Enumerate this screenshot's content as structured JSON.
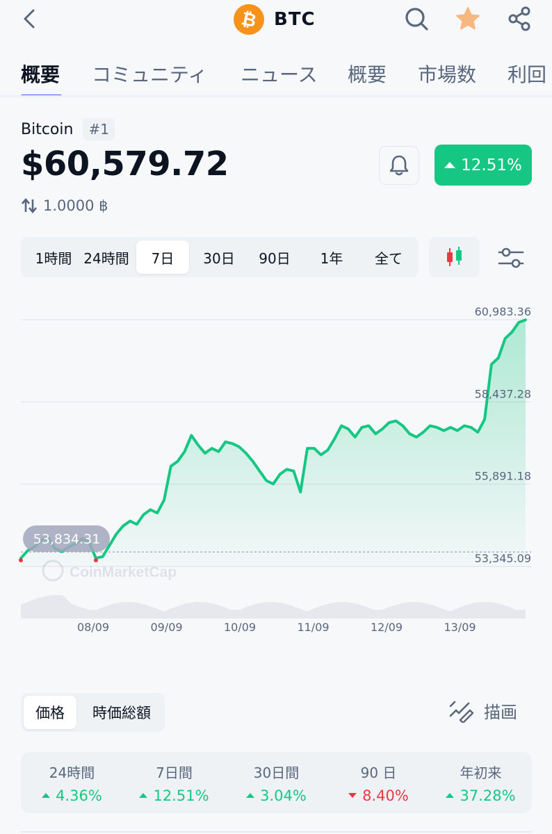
{
  "header": {
    "symbol": "BTC",
    "logo_glyph": "₿",
    "icons": [
      "back-icon",
      "search-icon",
      "star-icon",
      "share-icon"
    ],
    "accent": "#f7931a",
    "star_color": "#f6b87e"
  },
  "tabs": [
    {
      "label": "概要",
      "active": true
    },
    {
      "label": "コミュニティ",
      "active": false
    },
    {
      "label": "ニュース",
      "active": false
    },
    {
      "label": "概要",
      "active": false
    },
    {
      "label": "市場数",
      "active": false
    },
    {
      "label": "利回",
      "active": false
    }
  ],
  "coin": {
    "name": "Bitcoin",
    "rank": "#1",
    "price": "$60,579.72",
    "change": "12.51%",
    "change_color": "#16c784",
    "btc_amount": "1.0000 ฿"
  },
  "ranges": [
    {
      "label": "1時間",
      "active": false
    },
    {
      "label": "24時間",
      "active": false
    },
    {
      "label": "7日",
      "active": true
    },
    {
      "label": "30日",
      "active": false
    },
    {
      "label": "90日",
      "active": false
    },
    {
      "label": "1年",
      "active": false
    },
    {
      "label": "全て",
      "active": false
    }
  ],
  "chart_data": {
    "type": "area",
    "y_ticks": [
      "60,983.36",
      "58,437.28",
      "55,891.18",
      "53,345.09"
    ],
    "ylim": [
      53345.09,
      60983.36
    ],
    "x_ticks": [
      "08/09",
      "09/09",
      "10/09",
      "11/09",
      "12/09",
      "13/09"
    ],
    "open_label": "53,834.31",
    "watermark": "CoinMarketCap",
    "line_color": "#16c784",
    "series": [
      {
        "values": [
          53600,
          53834,
          53950,
          54150,
          54250,
          53900,
          53800,
          53950,
          54050,
          54200,
          54100,
          53600,
          53650,
          54000,
          54350,
          54600,
          54750,
          54650,
          54950,
          55100,
          55000,
          55400,
          56450,
          56600,
          56900,
          57400,
          57100,
          56850,
          57000,
          56900,
          57200,
          57150,
          57050,
          56850,
          56600,
          56300,
          56000,
          55900,
          56200,
          56350,
          56300,
          55650,
          57000,
          57000,
          56800,
          56950,
          57300,
          57700,
          57600,
          57350,
          57650,
          57700,
          57450,
          57600,
          57800,
          57850,
          57700,
          57450,
          57350,
          57500,
          57700,
          57650,
          57550,
          57650,
          57550,
          57700,
          57650,
          57500,
          57900,
          59600,
          59800,
          60400,
          60600,
          60900,
          60979
        ]
      }
    ]
  },
  "toggle": [
    {
      "label": "価格",
      "active": true
    },
    {
      "label": "時価総額",
      "active": false
    }
  ],
  "draw_label": "描画",
  "performance": [
    {
      "label": "24時間",
      "value": "4.36%",
      "direction": "up"
    },
    {
      "label": "7日間",
      "value": "12.51%",
      "direction": "up"
    },
    {
      "label": "30日間",
      "value": "3.04%",
      "direction": "up"
    },
    {
      "label": "90 日",
      "value": "8.40%",
      "direction": "down"
    },
    {
      "label": "年初来",
      "value": "37.28%",
      "direction": "up"
    }
  ]
}
